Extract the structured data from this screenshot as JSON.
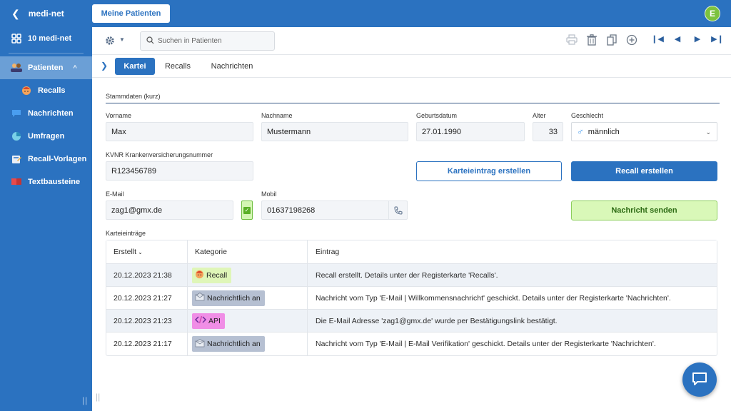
{
  "sidebar": {
    "app_title": "medi-net",
    "dashboard_label": "10 medi-net",
    "items": [
      {
        "label": "Patienten",
        "icon": "patients-icon"
      },
      {
        "label": "Recalls",
        "icon": "recall-face-icon"
      },
      {
        "label": "Nachrichten",
        "icon": "chat-bubble-icon"
      },
      {
        "label": "Umfragen",
        "icon": "pie-chart-icon"
      },
      {
        "label": "Recall-Vorlagen",
        "icon": "template-icon"
      },
      {
        "label": "Textbausteine",
        "icon": "book-icon"
      }
    ]
  },
  "topbar": {
    "main_tab": "Meine Patienten",
    "avatar_initial": "E"
  },
  "toolbar": {
    "search_placeholder": "Suchen in Patienten"
  },
  "tabs": [
    "Kartei",
    "Recalls",
    "Nachrichten"
  ],
  "form": {
    "section_title": "Stammdaten (kurz)",
    "vorname_label": "Vorname",
    "vorname": "Max",
    "nachname_label": "Nachname",
    "nachname": "Mustermann",
    "geburtsdatum_label": "Geburtsdatum",
    "geburtsdatum": "27.01.1990",
    "alter_label": "Alter",
    "alter": "33",
    "geschlecht_label": "Geschlecht",
    "geschlecht": "männlich",
    "kvnr_label": "KVNR Krankenversicherungsnummer",
    "kvnr": "R123456789",
    "email_label": "E-Mail",
    "email": "zag1@gmx.de",
    "mobil_label": "Mobil",
    "mobil": "01637198268",
    "btn_kartei": "Karteieintrag erstellen",
    "btn_recall": "Recall erstellen",
    "btn_nachricht": "Nachricht senden"
  },
  "entries": {
    "title": "Karteieinträge",
    "columns": [
      "Erstellt",
      "Kategorie",
      "Eintrag"
    ],
    "rows": [
      {
        "date": "20.12.2023 21:38",
        "category": "Recall",
        "type": "recall",
        "text": "Recall erstellt. Details unter der Registerkarte 'Recalls'."
      },
      {
        "date": "20.12.2023 21:27",
        "category": "Nachrichtlich an",
        "type": "msg",
        "text": "Nachricht vom Typ 'E-Mail | Willkommensnachricht' geschickt. Details unter der Registerkarte 'Nachrichten'."
      },
      {
        "date": "20.12.2023 21:23",
        "category": "API",
        "type": "api",
        "text": "Die E-Mail Adresse 'zag1@gmx.de' wurde per Bestätigungslink bestätigt."
      },
      {
        "date": "20.12.2023 21:17",
        "category": "Nachrichtlich an",
        "type": "msg",
        "text": "Nachricht vom Typ 'E-Mail | E-Mail Verifikation' geschickt. Details unter der Registerkarte 'Nachrichten'."
      }
    ]
  },
  "colors": {
    "primary": "#2b72c0",
    "recall_tag": "#dff6b8",
    "msg_tag": "#b6c0d2",
    "api_tag": "#f08ee6",
    "avatar": "#7cc23e"
  }
}
